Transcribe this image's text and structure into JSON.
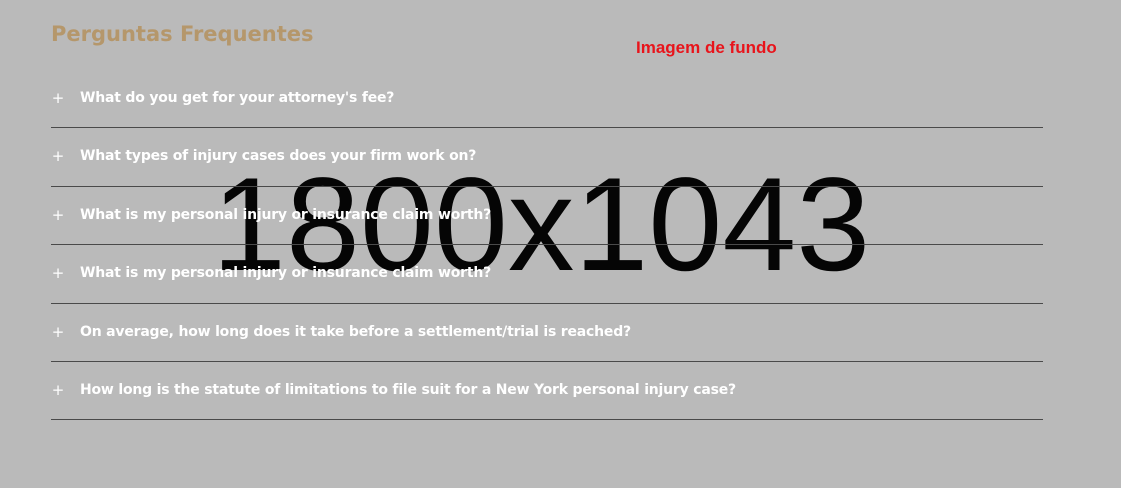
{
  "background": {
    "caption": "Imagem de fundo",
    "dimensions": "1800x1043",
    "caption_color": "#e8141b",
    "background_color": "#bababa"
  },
  "faq": {
    "title": "Perguntas Frequentes",
    "title_color": "#b5976b",
    "expand_icon": "plus-icon",
    "items": [
      {
        "question": "What do you get for your attorney's fee?",
        "icon": "+"
      },
      {
        "question": "What types of injury cases does your firm work on?",
        "icon": "+"
      },
      {
        "question": "What is my personal injury or insurance claim worth?",
        "icon": "+"
      },
      {
        "question": "What is my personal injury or insurance claim worth?",
        "icon": "+"
      },
      {
        "question": "On average, how long does it take before a settlement/trial is reached?",
        "icon": "+"
      },
      {
        "question": "How long is the statute of limitations to file suit for a New York personal injury case?",
        "icon": "+"
      }
    ]
  }
}
